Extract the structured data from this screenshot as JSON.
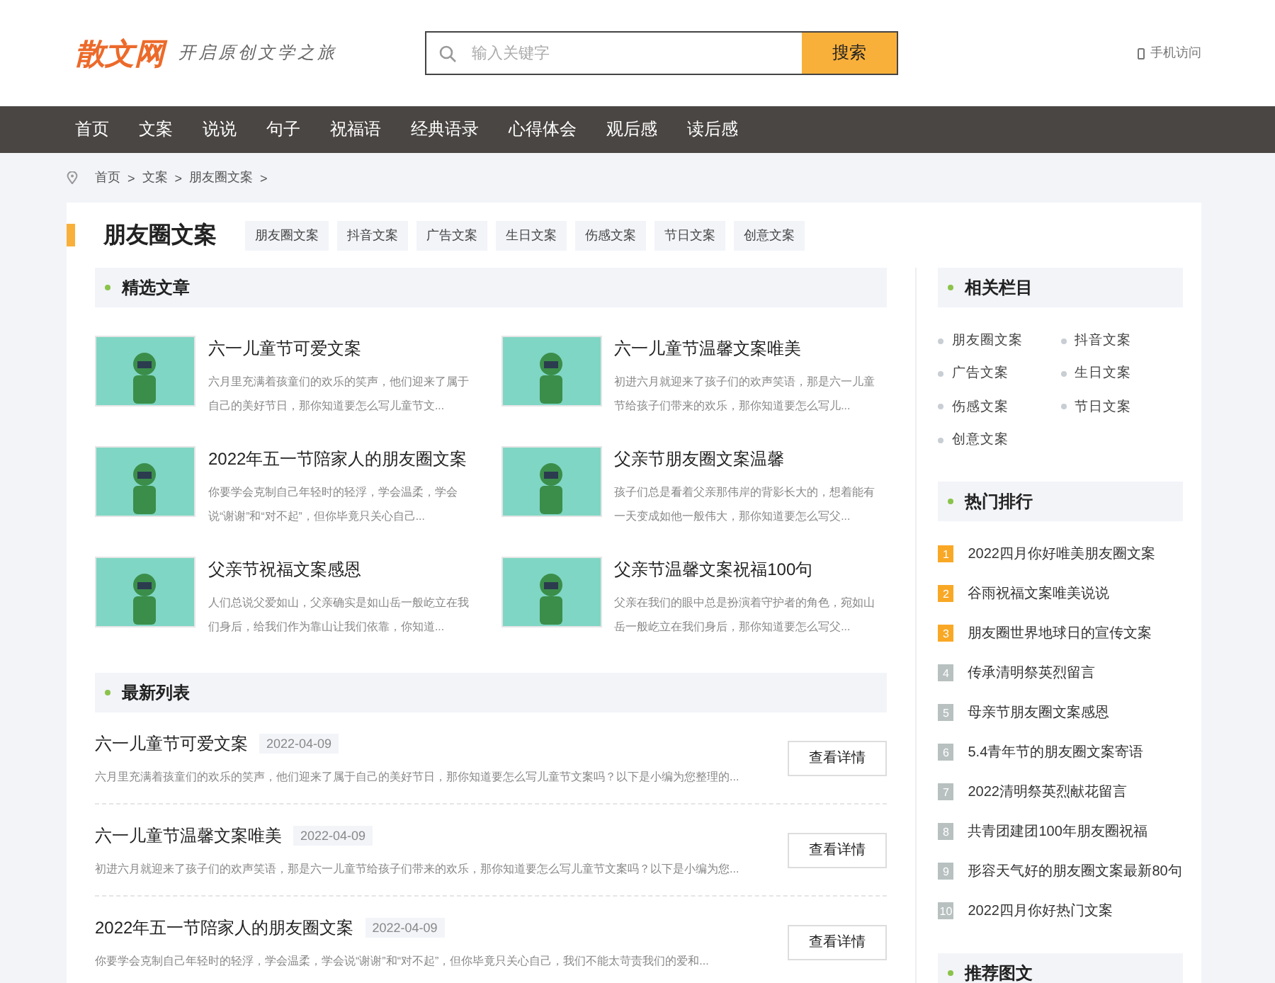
{
  "header": {
    "logo": "散文网",
    "slogan": "开启原创文学之旅",
    "search": {
      "placeholder": "输入关键字",
      "button": "搜索"
    },
    "mobile_link": "手机访问"
  },
  "nav": [
    {
      "label": "首页"
    },
    {
      "label": "文案"
    },
    {
      "label": "说说"
    },
    {
      "label": "句子"
    },
    {
      "label": "祝福语"
    },
    {
      "label": "经典语录"
    },
    {
      "label": "心得体会"
    },
    {
      "label": "观后感"
    },
    {
      "label": "读后感"
    }
  ],
  "breadcrumb": [
    "首页",
    "文案",
    "朋友圈文案"
  ],
  "breadcrumb_separator": ">",
  "category": {
    "title": "朋友圈文案",
    "tags": [
      "朋友圈文案",
      "抖音文案",
      "广告文案",
      "生日文案",
      "伤感文案",
      "节日文案",
      "创意文案"
    ]
  },
  "featured": {
    "title": "精选文章",
    "items": [
      {
        "title": "六一儿童节可爱文案",
        "excerpt": "六月里充满着孩童们的欢乐的笑声，他们迎来了属于自己的美好节日，那你知道要怎么写儿童节文..."
      },
      {
        "title": "六一儿童节温馨文案唯美",
        "excerpt": "初进六月就迎来了孩子们的欢声笑语，那是六一儿童节给孩子们带来的欢乐，那你知道要怎么写儿..."
      },
      {
        "title": "2022年五一节陪家人的朋友圈文案",
        "excerpt": "你要学会克制自己年轻时的轻浮，学会温柔，学会说“谢谢”和“对不起”，但你毕竟只关心自己..."
      },
      {
        "title": "父亲节朋友圈文案温馨",
        "excerpt": "孩子们总是看着父亲那伟岸的背影长大的，想着能有一天变成如他一般伟大，那你知道要怎么写父..."
      },
      {
        "title": "父亲节祝福文案感恩",
        "excerpt": "人们总说父爱如山，父亲确实是如山岳一般屹立在我们身后，给我们作为靠山让我们依靠，你知道..."
      },
      {
        "title": "父亲节温馨文案祝福100句",
        "excerpt": "父亲在我们的眼中总是扮演着守护者的角色，宛如山岳一般屹立在我们身后，那你知道要怎么写父..."
      }
    ]
  },
  "latest": {
    "title": "最新列表",
    "items": [
      {
        "title": "六一儿童节可爱文案",
        "date": "2022-04-09",
        "excerpt": "六月里充满着孩童们的欢乐的笑声，他们迎来了属于自己的美好节日，那你知道要怎么写儿童节文案吗？以下是小编为您整理的...",
        "button": "查看详情"
      },
      {
        "title": "六一儿童节温馨文案唯美",
        "date": "2022-04-09",
        "excerpt": "初进六月就迎来了孩子们的欢声笑语，那是六一儿童节给孩子们带来的欢乐，那你知道要怎么写儿童节文案吗？以下是小编为您...",
        "button": "查看详情"
      },
      {
        "title": "2022年五一节陪家人的朋友圈文案",
        "date": "2022-04-09",
        "excerpt": "你要学会克制自己年轻时的轻浮，学会温柔，学会说“谢谢”和“对不起”，但你毕竟只关心自己，我们不能太苛责我们的爱和...",
        "button": "查看详情"
      }
    ]
  },
  "sidebar": {
    "related": {
      "title": "相关栏目",
      "links": [
        "朋友圈文案",
        "抖音文案",
        "广告文案",
        "生日文案",
        "伤感文案",
        "节日文案",
        "创意文案"
      ]
    },
    "ranking": {
      "title": "热门排行",
      "items": [
        {
          "rank": "1",
          "title": "2022四月你好唯美朋友圈文案",
          "top": true
        },
        {
          "rank": "2",
          "title": "谷雨祝福文案唯美说说",
          "top": true
        },
        {
          "rank": "3",
          "title": "朋友圈世界地球日的宣传文案",
          "top": true
        },
        {
          "rank": "4",
          "title": "传承清明祭英烈留言",
          "top": false
        },
        {
          "rank": "5",
          "title": "母亲节朋友圈文案感恩",
          "top": false
        },
        {
          "rank": "6",
          "title": "5.4青年节的朋友圈文案寄语",
          "top": false
        },
        {
          "rank": "7",
          "title": "2022清明祭英烈献花留言",
          "top": false
        },
        {
          "rank": "8",
          "title": "共青团建团100年朋友圈祝福",
          "top": false
        },
        {
          "rank": "9",
          "title": "形容天气好的朋友圈文案最新80句",
          "top": false
        },
        {
          "rank": "10",
          "title": "2022四月你好热门文案",
          "top": false
        }
      ]
    },
    "recommended": {
      "title": "推荐图文"
    }
  }
}
